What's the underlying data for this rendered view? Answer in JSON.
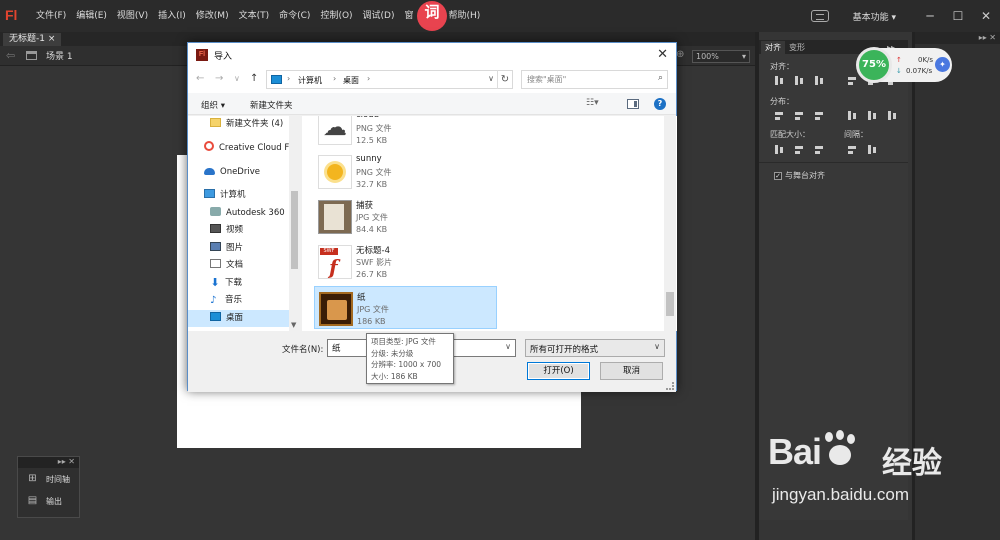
{
  "app": {
    "logo": "Fl",
    "menu": [
      "文件(F)",
      "编辑(E)",
      "视图(V)",
      "插入(I)",
      "修改(M)",
      "文本(T)",
      "命令(C)",
      "控制(O)",
      "调试(D)",
      "窗",
      "帮助(H)"
    ],
    "overlay_badge": "词",
    "workspace_label": "基本功能 ▾",
    "window_buttons": {
      "minimize": "─",
      "maximize": "☐",
      "close": "✕"
    },
    "doc_tab": "无标题-1 ×",
    "scene_label": "场景 1",
    "zoom": "100%"
  },
  "timeline_panel": {
    "controls": "▸▸ ✕",
    "items": [
      {
        "label": "时间轴",
        "icon": "timeline-icon"
      },
      {
        "label": "输出",
        "icon": "output-icon"
      }
    ]
  },
  "align_panel": {
    "tabs": [
      "对齐",
      "变形"
    ],
    "header_controls": "▸▸ ✕",
    "sections": {
      "align": "对齐：",
      "distribute": "分布：",
      "match_size": "匹配大小：",
      "spacing": "间隔："
    },
    "align_to_stage": "与舞台对齐",
    "align_to_stage_checked": true
  },
  "far_panel": {
    "header_controls": "▸▸ ✕"
  },
  "speed_widget": {
    "percent": "75%",
    "up": "0K/s",
    "down": "0.07K/s"
  },
  "watermark": {
    "logo_left": "Bai",
    "logo_suffix": "经验",
    "url": "jingyan.baidu.com"
  },
  "dialog": {
    "title": "导入",
    "close": "✕",
    "address": {
      "crumbs": [
        "计算机",
        "桌面"
      ]
    },
    "search_placeholder": "搜索\"桌面\"",
    "toolbar": {
      "organize": "组织 ▾",
      "new_folder": "新建文件夹"
    },
    "nav_items": [
      {
        "label": "新建文件夹 (4)",
        "icon": "folder"
      },
      {
        "label": "Creative Cloud F",
        "icon": "cc"
      },
      {
        "label": "OneDrive",
        "icon": "cloud"
      },
      {
        "label": "计算机",
        "icon": "pc"
      },
      {
        "label": "Autodesk 360",
        "icon": "disk"
      },
      {
        "label": "视频",
        "icon": "video"
      },
      {
        "label": "图片",
        "icon": "pic"
      },
      {
        "label": "文档",
        "icon": "doc"
      },
      {
        "label": "下载",
        "icon": "down"
      },
      {
        "label": "音乐",
        "icon": "music"
      },
      {
        "label": "桌面",
        "icon": "desk",
        "selected": true
      }
    ],
    "files": [
      {
        "name": "cloud",
        "type": "PNG 文件",
        "size": "12.5 KB",
        "thumb": "cloud"
      },
      {
        "name": "sunny",
        "type": "PNG 文件",
        "size": "32.7 KB",
        "thumb": "sun"
      },
      {
        "name": "捕获",
        "type": "JPG 文件",
        "size": "84.4 KB",
        "thumb": "shot"
      },
      {
        "name": "无标题-4",
        "type": "SWF 影片",
        "size": "26.7 KB",
        "thumb": "swf"
      },
      {
        "name": "纸",
        "type": "JPG 文件",
        "size": "186 KB",
        "thumb": "paper",
        "selected": true
      }
    ],
    "filename_label": "文件名(N):",
    "filename_value": "纸",
    "filter_value": "所有可打开的格式",
    "open_button": "打开(O)",
    "cancel_button": "取消",
    "tooltip": [
      "项目类型: JPG 文件",
      "分级: 未分级",
      "分辨率: 1000 x 700",
      "大小: 186 KB"
    ]
  }
}
